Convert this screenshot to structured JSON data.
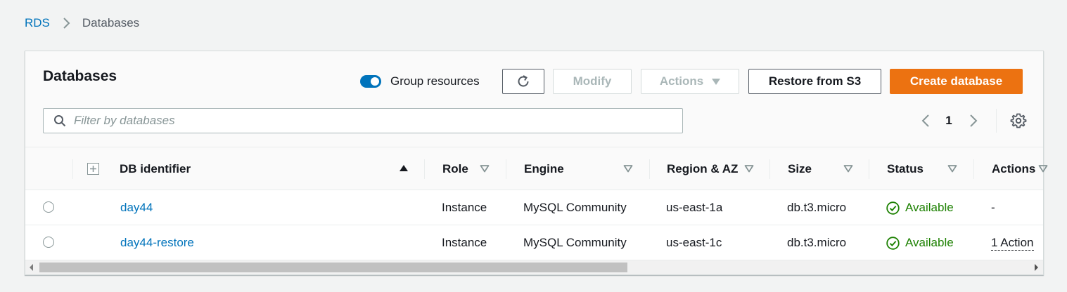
{
  "breadcrumb": {
    "root": "RDS",
    "current": "Databases"
  },
  "panel": {
    "title": "Databases",
    "group_resources_label": "Group resources",
    "group_resources_on": true,
    "buttons": {
      "modify": "Modify",
      "actions": "Actions",
      "restore": "Restore from S3",
      "create": "Create database"
    },
    "search_placeholder": "Filter by databases",
    "search_value": "",
    "page": "1"
  },
  "table": {
    "columns": [
      "DB identifier",
      "Role",
      "Engine",
      "Region & AZ",
      "Size",
      "Status",
      "Actions"
    ],
    "rows": [
      {
        "id": "day44",
        "role": "Instance",
        "engine": "MySQL Community",
        "region": "us-east-1a",
        "size": "db.t3.micro",
        "status": "Available",
        "actions": "-"
      },
      {
        "id": "day44-restore",
        "role": "Instance",
        "engine": "MySQL Community",
        "region": "us-east-1c",
        "size": "db.t3.micro",
        "status": "Available",
        "actions": "1 Action"
      }
    ]
  },
  "colors": {
    "link": "#0073bb",
    "primary": "#ec7211",
    "success": "#1d8102",
    "toggle": "#0073bb"
  },
  "icons": [
    "chevron-right-icon",
    "refresh-icon",
    "caret-down-icon",
    "search-icon",
    "chevron-left-icon",
    "gear-icon",
    "expand-all-icon",
    "sort-ascending-icon",
    "sort-icon",
    "check-circle-icon"
  ]
}
